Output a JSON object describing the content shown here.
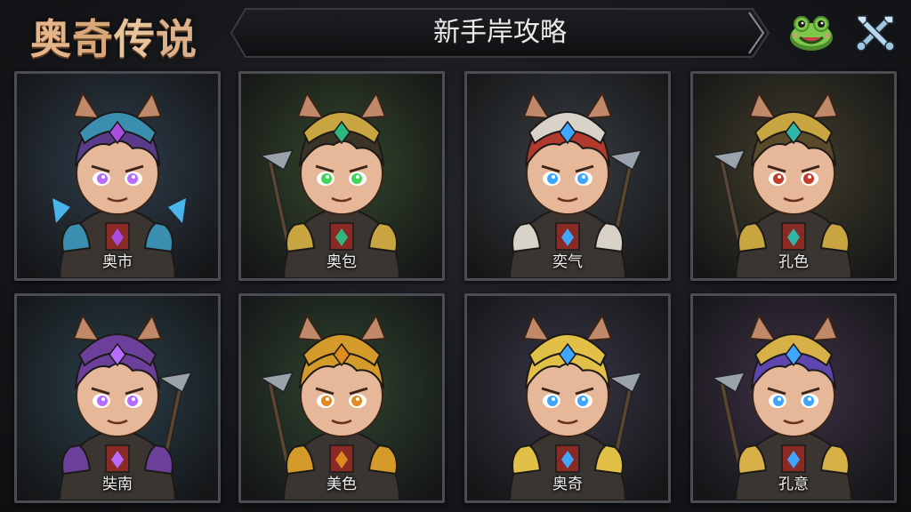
{
  "header": {
    "logo": [
      "奥",
      "奇",
      "传",
      "说"
    ],
    "title": "新手岸攻略"
  },
  "icons": {
    "left_button": "frog-face-icon",
    "right_button": "crossed-tools-icon"
  },
  "heroes": [
    {
      "name": "奥市",
      "bg": "#2f3d4c",
      "hair": "#5a3a8a",
      "eyes": "#b86bff",
      "helm": "#3a8fb0",
      "gem": "#a84de0"
    },
    {
      "name": "奥包",
      "bg": "#34472c",
      "hair": "#3a3326",
      "eyes": "#43d65a",
      "helm": "#c8a540",
      "gem": "#2fb87e"
    },
    {
      "name": "奕气",
      "bg": "#3a3f44",
      "hair": "#b23a2c",
      "eyes": "#3ea6ff",
      "helm": "#d8d2c8",
      "gem": "#3ea6ff"
    },
    {
      "name": "孔色",
      "bg": "#433f2c",
      "hair": "#5a4a2a",
      "eyes": "#c23a2a",
      "helm": "#c8a540",
      "gem": "#2fb8a8"
    },
    {
      "name": "奘南",
      "bg": "#2a3f4a",
      "hair": "#6b3f9a",
      "eyes": "#b86bff",
      "helm": "#6b3f9a",
      "gem": "#b86bff"
    },
    {
      "name": "美色",
      "bg": "#2f4530",
      "hair": "#d49a2a",
      "eyes": "#e08a20",
      "helm": "#d49a2a",
      "gem": "#e08a20"
    },
    {
      "name": "奥奇",
      "bg": "#3a3748",
      "hair": "#e2c048",
      "eyes": "#3ea6ff",
      "helm": "#e2c048",
      "gem": "#3ea6ff"
    },
    {
      "name": "孔意",
      "bg": "#3f3148",
      "hair": "#5e46b0",
      "eyes": "#3ea6ff",
      "helm": "#d8b048",
      "gem": "#3ea6ff"
    }
  ]
}
